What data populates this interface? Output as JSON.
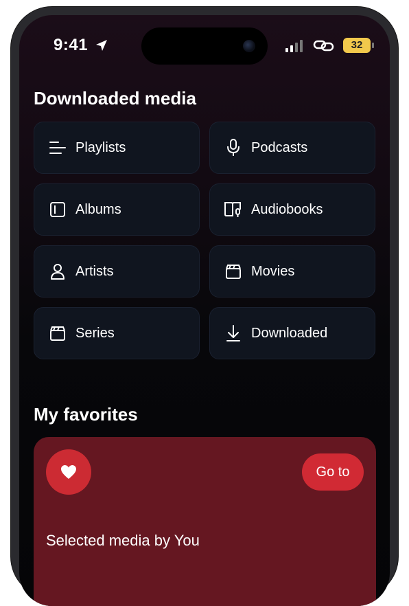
{
  "status_bar": {
    "time": "9:41",
    "battery": "32",
    "battery_color": "#f2c94c",
    "icons": [
      "location-arrow-icon",
      "signal-bars-icon",
      "link-icon",
      "battery-icon"
    ]
  },
  "downloaded": {
    "title": "Downloaded media",
    "items": [
      {
        "label": "Playlists",
        "icon": "list-icon"
      },
      {
        "label": "Podcasts",
        "icon": "microphone-icon"
      },
      {
        "label": "Albums",
        "icon": "album-icon"
      },
      {
        "label": "Audiobooks",
        "icon": "audiobook-icon"
      },
      {
        "label": "Artists",
        "icon": "person-icon"
      },
      {
        "label": "Movies",
        "icon": "clapperboard-icon"
      },
      {
        "label": "Series",
        "icon": "clapperboard-icon"
      },
      {
        "label": "Downloaded",
        "icon": "download-icon"
      }
    ]
  },
  "favorites": {
    "title": "My favorites",
    "goto_label": "Go to",
    "caption": "Selected media by You",
    "card_color": "#651721",
    "accent_color": "#cc2b33"
  }
}
